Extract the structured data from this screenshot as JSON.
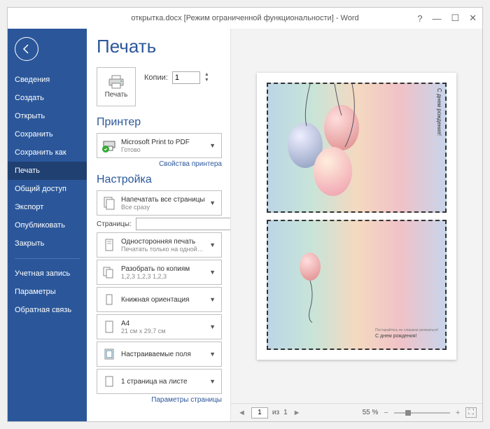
{
  "title": "открытка.docx [Режим ограниченной функциональности] - Word",
  "sidebar": {
    "items": [
      {
        "label": "Сведения"
      },
      {
        "label": "Создать"
      },
      {
        "label": "Открыть"
      },
      {
        "label": "Сохранить"
      },
      {
        "label": "Сохранить как"
      },
      {
        "label": "Печать"
      },
      {
        "label": "Общий доступ"
      },
      {
        "label": "Экспорт"
      },
      {
        "label": "Опубликовать"
      },
      {
        "label": "Закрыть"
      }
    ],
    "footer": [
      {
        "label": "Учетная запись"
      },
      {
        "label": "Параметры"
      },
      {
        "label": "Обратная связь"
      }
    ]
  },
  "page_title": "Печать",
  "print_button": "Печать",
  "copies_label": "Копии:",
  "copies_value": "1",
  "printer_section": "Принтер",
  "printer": {
    "line1": "Microsoft Print to PDF",
    "line2": "Готово"
  },
  "printer_props": "Свойства принтера",
  "settings_section": "Настройка",
  "opt_all": {
    "line1": "Напечатать все страницы",
    "line2": "Все сразу"
  },
  "pages_label": "Страницы:",
  "pages_value": "",
  "opt_oneside": {
    "line1": "Односторонняя печать",
    "line2": "Печатать только на одной…"
  },
  "opt_collate": {
    "line1": "Разобрать по копиям",
    "line2": "1,2,3   1,2,3   1,2,3"
  },
  "opt_orient": {
    "line1": "Книжная ориентация"
  },
  "opt_size": {
    "line1": "A4",
    "line2": "21 см x 29,7 см"
  },
  "opt_margins": {
    "line1": "Настраиваемые поля"
  },
  "opt_ppp": {
    "line1": "1 страница на листе"
  },
  "page_params": "Параметры страницы",
  "preview": {
    "card1_text": "С днем рождения!",
    "card2_small": "Постарайтесь не слишком увлекаться!",
    "card2_big": "С днем рождения!"
  },
  "footer": {
    "page_current": "1",
    "page_of": "из",
    "page_total": "1",
    "zoom": "55 %"
  }
}
